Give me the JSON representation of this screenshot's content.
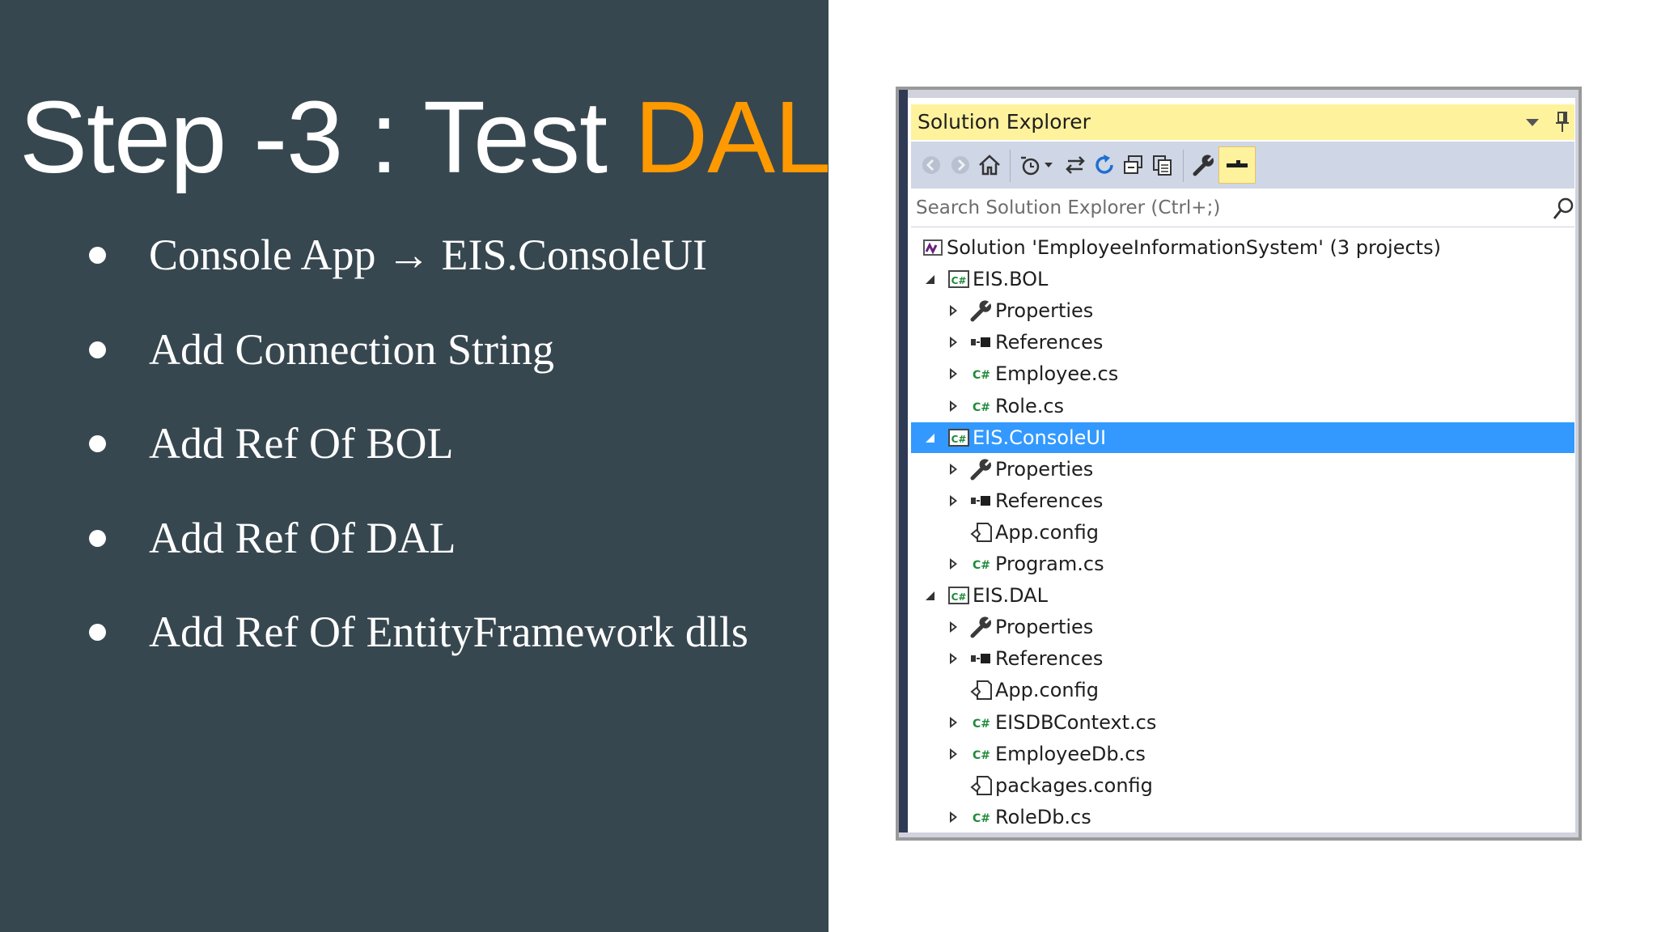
{
  "slide": {
    "title_main": "Step -3 : Test ",
    "title_accent": "DAL",
    "colors": {
      "background": "#37474f",
      "accent": "#ff9900",
      "text": "#ffffff"
    },
    "bullets": [
      {
        "text": "Console App → EIS.ConsoleUI"
      },
      {
        "text": "Add Connection String"
      },
      {
        "text": "Add Ref Of BOL"
      },
      {
        "text": "Add Ref Of DAL"
      },
      {
        "text": "Add Ref Of EntityFramework dlls"
      }
    ]
  },
  "solution_explorer": {
    "title": "Solution Explorer",
    "search_placeholder": "Search Solution Explorer (Ctrl+;)",
    "colors": {
      "title_bar": "#fff29d",
      "toolbar": "#cfd6e5",
      "selection": "#3399ff",
      "csharp_green": "#1e8a3a"
    },
    "toolbar_icons": [
      "back-icon",
      "forward-icon",
      "home-icon",
      "pending-changes-filter-icon",
      "sync-with-active-document-icon",
      "refresh-icon",
      "collapse-all-icon",
      "show-all-files-icon",
      "properties-icon",
      "preview-selected-items-icon"
    ],
    "tree": [
      {
        "label": "Solution 'EmployeeInformationSystem' (3 projects)",
        "icon": "solution-icon",
        "expander": "none",
        "indent": 0,
        "selected": false
      },
      {
        "label": "EIS.BOL",
        "icon": "csharp-project-icon",
        "expander": "expanded",
        "indent": 1,
        "selected": false
      },
      {
        "label": "Properties",
        "icon": "wrench-icon",
        "expander": "collapsed",
        "indent": 2,
        "selected": false
      },
      {
        "label": "References",
        "icon": "references-icon",
        "expander": "collapsed",
        "indent": 2,
        "selected": false
      },
      {
        "label": "Employee.cs",
        "icon": "csharp-file-icon",
        "expander": "collapsed",
        "indent": 2,
        "selected": false
      },
      {
        "label": "Role.cs",
        "icon": "csharp-file-icon",
        "expander": "collapsed",
        "indent": 2,
        "selected": false
      },
      {
        "label": "EIS.ConsoleUI",
        "icon": "csharp-project-icon",
        "expander": "expanded",
        "indent": 1,
        "selected": true
      },
      {
        "label": "Properties",
        "icon": "wrench-icon",
        "expander": "collapsed",
        "indent": 2,
        "selected": false
      },
      {
        "label": "References",
        "icon": "references-icon",
        "expander": "collapsed",
        "indent": 2,
        "selected": false
      },
      {
        "label": "App.config",
        "icon": "config-file-icon",
        "expander": "none",
        "indent": 2,
        "selected": false
      },
      {
        "label": "Program.cs",
        "icon": "csharp-file-icon",
        "expander": "collapsed",
        "indent": 2,
        "selected": false
      },
      {
        "label": "EIS.DAL",
        "icon": "csharp-project-icon",
        "expander": "expanded",
        "indent": 1,
        "selected": false
      },
      {
        "label": "Properties",
        "icon": "wrench-icon",
        "expander": "collapsed",
        "indent": 2,
        "selected": false
      },
      {
        "label": "References",
        "icon": "references-icon",
        "expander": "collapsed",
        "indent": 2,
        "selected": false
      },
      {
        "label": "App.config",
        "icon": "config-file-icon",
        "expander": "none",
        "indent": 2,
        "selected": false
      },
      {
        "label": "EISDBContext.cs",
        "icon": "csharp-file-icon",
        "expander": "collapsed",
        "indent": 2,
        "selected": false
      },
      {
        "label": "EmployeeDb.cs",
        "icon": "csharp-file-icon",
        "expander": "collapsed",
        "indent": 2,
        "selected": false
      },
      {
        "label": "packages.config",
        "icon": "config-file-icon",
        "expander": "none",
        "indent": 2,
        "selected": false
      },
      {
        "label": "RoleDb.cs",
        "icon": "csharp-file-icon",
        "expander": "collapsed",
        "indent": 2,
        "selected": false
      }
    ]
  }
}
